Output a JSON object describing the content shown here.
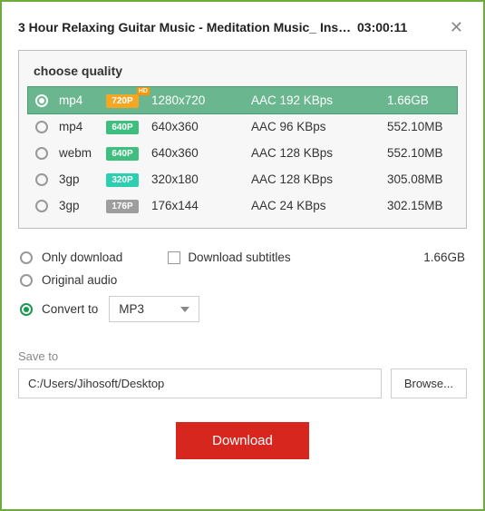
{
  "header": {
    "title": "3 Hour Relaxing Guitar Music - Meditation Music_ Instru…-",
    "duration": "03:00:11"
  },
  "quality": {
    "label": "choose quality",
    "rows": [
      {
        "format": "mp4",
        "badge": "720P",
        "badge_color": "#f5a623",
        "hd": "HD",
        "resolution": "1280x720",
        "codec": "AAC 192 KBps",
        "size": "1.66GB",
        "selected": true
      },
      {
        "format": "mp4",
        "badge": "640P",
        "badge_color": "#3fbf7f",
        "resolution": "640x360",
        "codec": "AAC 96 KBps",
        "size": "552.10MB",
        "selected": false
      },
      {
        "format": "webm",
        "badge": "640P",
        "badge_color": "#3fbf7f",
        "resolution": "640x360",
        "codec": "AAC 128 KBps",
        "size": "552.10MB",
        "selected": false
      },
      {
        "format": "3gp",
        "badge": "320P",
        "badge_color": "#2ecfb0",
        "resolution": "320x180",
        "codec": "AAC 128 KBps",
        "size": "305.08MB",
        "selected": false
      },
      {
        "format": "3gp",
        "badge": "176P",
        "badge_color": "#9e9e9e",
        "resolution": "176x144",
        "codec": "AAC 24 KBps",
        "size": "302.15MB",
        "selected": false
      }
    ]
  },
  "options": {
    "only_download": "Only download",
    "subtitles": "Download subtitles",
    "total_size": "1.66GB",
    "original_audio": "Original audio",
    "convert_to": "Convert to",
    "convert_value": "MP3"
  },
  "save": {
    "label": "Save to",
    "path": "C:/Users/Jihosoft/Desktop",
    "browse": "Browse..."
  },
  "download_button": "Download"
}
